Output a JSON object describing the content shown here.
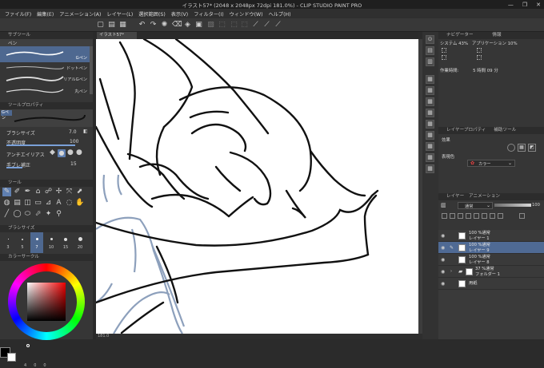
{
  "window": {
    "title": "イラスト57* (2048 x 2048px 72dpi 181.0%) - CLIP STUDIO PAINT PRO",
    "controls": [
      "—",
      "❐",
      "✕"
    ]
  },
  "menu": [
    "ファイル(F)",
    "編集(E)",
    "アニメーション(A)",
    "レイヤー(L)",
    "選択範囲(S)",
    "表示(V)",
    "フィルター(I)",
    "ウィンドウ(W)",
    "ヘルプ(H)"
  ],
  "canvas": {
    "tab_label": "イラスト57*",
    "zoom": "181.0"
  },
  "subtool": {
    "title": "サブツール",
    "tab": "ペン",
    "brushes": [
      "Gペン",
      "ドットペン",
      "リアルGペン",
      "丸ペン"
    ]
  },
  "tool_property": {
    "title": "ツールプロパティ",
    "current": "Gペン",
    "brush_size_label": "ブラシサイズ",
    "brush_size_value": "7.0",
    "opacity_label": "不透明度",
    "opacity_value": "100",
    "antialias_label": "アンチエイリアス",
    "stabilization_label": "手ブレ補正",
    "stabilization_value": "15"
  },
  "tool_panel": {
    "title": "ツール"
  },
  "brush_size_panel": {
    "title": "ブラシサイズ",
    "sizes": [
      "3",
      "5",
      "7",
      "10",
      "15",
      "20"
    ],
    "selected_index": 2
  },
  "color_circle": {
    "title": "カラーサークル",
    "h": "4",
    "s": "0",
    "v": "0"
  },
  "navigator": {
    "title": "ナビゲーター",
    "tab2": "情報",
    "system_label": "システム",
    "system_value": "43%",
    "app_label": "アプリケーション",
    "app_value": "10%",
    "work_time_label": "作業時間:",
    "work_time_value": "5 時間 09 分"
  },
  "layer_property": {
    "title": "レイヤープロパティ",
    "tab2": "補助ツール",
    "effect_label": "効果",
    "express_label": "表現色",
    "express_value": "カラー"
  },
  "layers": {
    "title": "レイヤー",
    "tab2": "アニメーション",
    "blend_mode": "通常",
    "opacity": "100",
    "items": [
      {
        "line1": "100 %通常",
        "line2": "レイヤー 1",
        "selected": false
      },
      {
        "line1": "100 %通常",
        "line2": "レイヤー 9",
        "selected": true
      },
      {
        "line1": "100 %通常",
        "line2": "レイヤー 8",
        "selected": false
      },
      {
        "line1": "37 %通常",
        "line2": "フォルダー 1",
        "selected": false
      },
      {
        "line1": "用紙",
        "line2": "",
        "selected": false
      }
    ]
  },
  "colors": {
    "accent": "#4f6a94",
    "main_color": "#000000",
    "sub_color": "#ffffff"
  }
}
